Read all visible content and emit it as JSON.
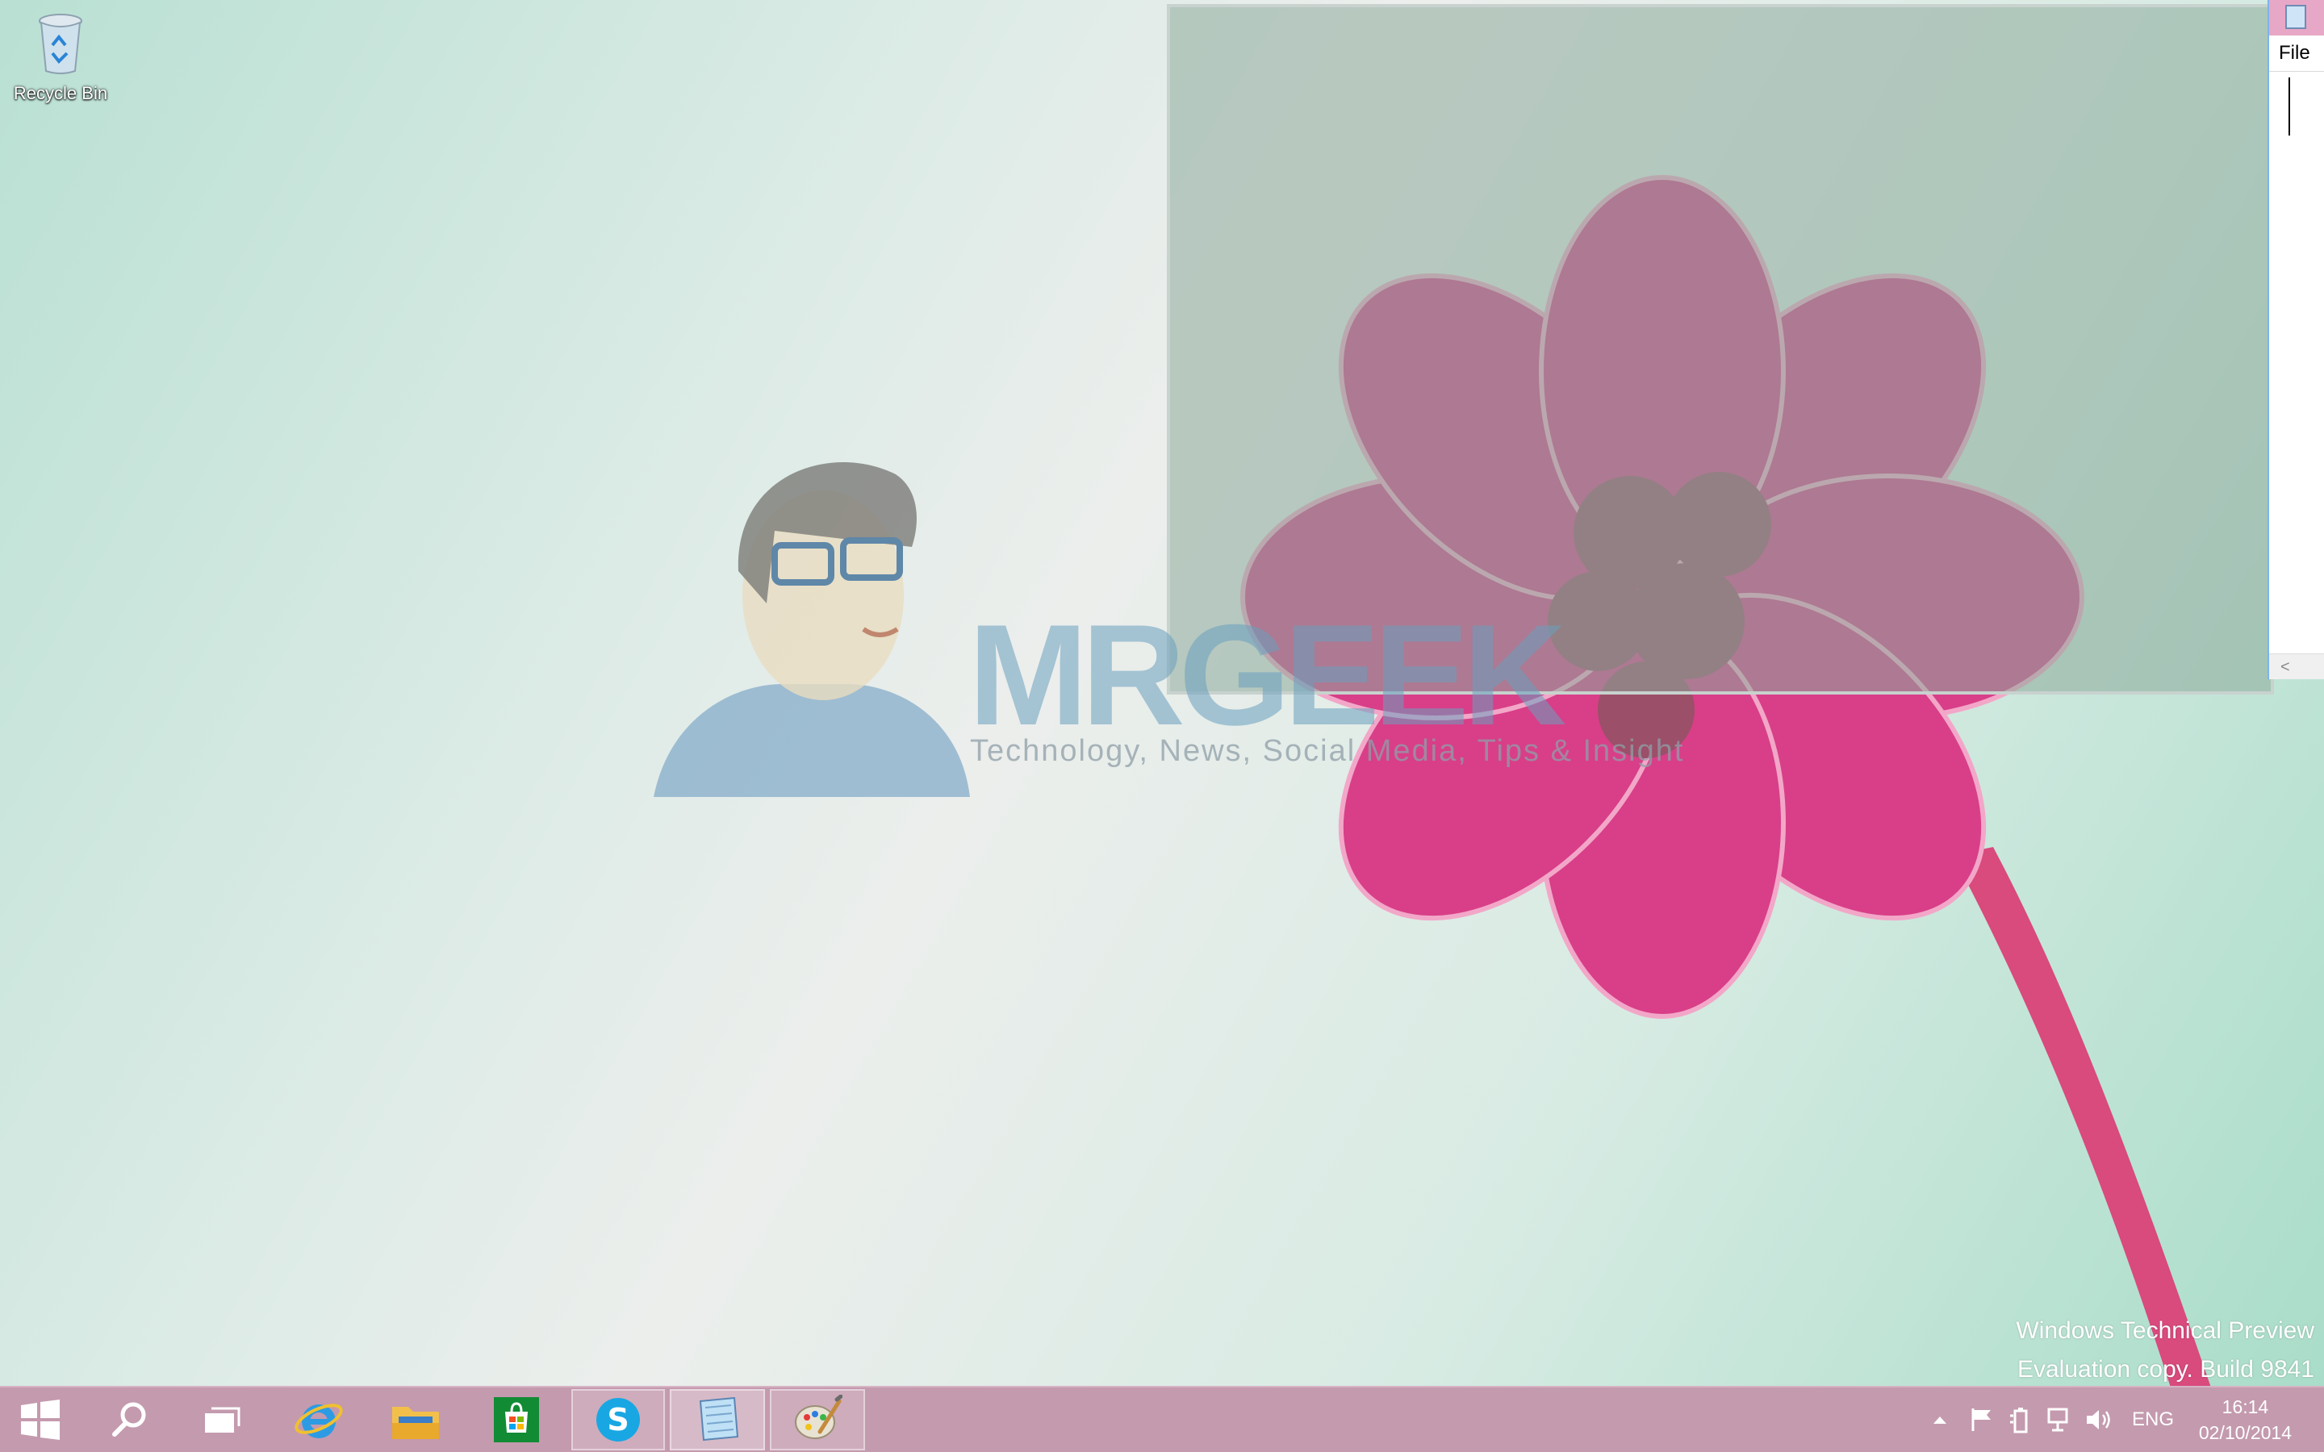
{
  "desktop": {
    "icons": [
      {
        "label": "Recycle Bin",
        "icon": "recycle-bin-icon"
      }
    ]
  },
  "watermark": {
    "brand": "MRGEEK",
    "tagline": "Technology, News, Social Media, Tips & Insight"
  },
  "notepad": {
    "menu_file": "File",
    "scroll_left": "<"
  },
  "build_info": {
    "line1": "Windows Technical Preview",
    "line2": "Evaluation copy. Build 9841"
  },
  "taskbar": {
    "pinned": [
      "start-icon",
      "search-icon",
      "task-view-icon",
      "internet-explorer-icon",
      "file-explorer-icon",
      "store-icon",
      "skype-icon",
      "notepad-icon",
      "paint-icon"
    ],
    "tray": {
      "language": "ENG",
      "time": "16:14",
      "date": "02/10/2014"
    }
  },
  "colors": {
    "taskbar": "#c49aae",
    "flower": "#d43c84",
    "accent": "#7eb4ea"
  }
}
